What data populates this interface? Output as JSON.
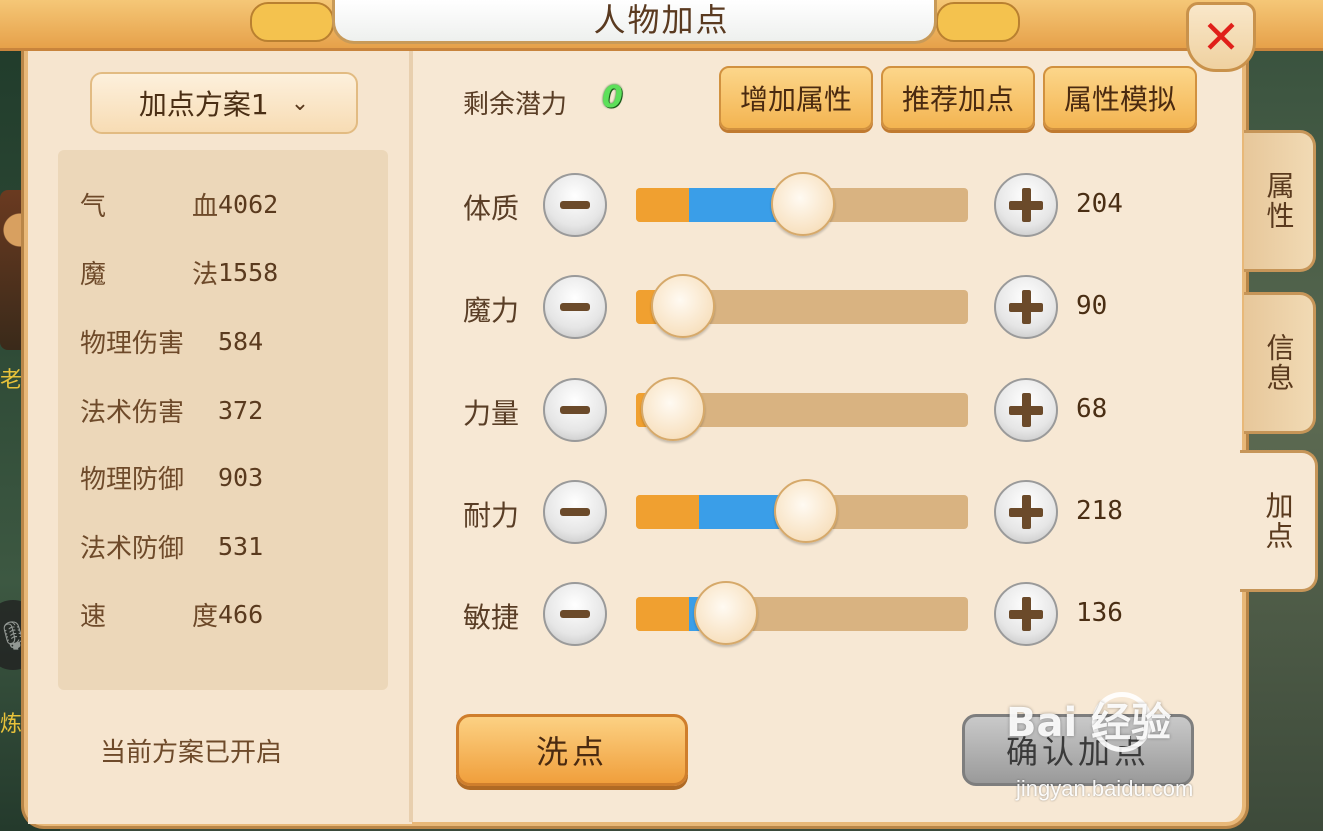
{
  "window": {
    "title": "人物加点",
    "close_icon": "close-icon"
  },
  "background": {
    "text_left_1": "老",
    "text_left_2": "炼"
  },
  "left_panel": {
    "scheme_selector": "加点方案1",
    "stats": [
      {
        "name_a": "气",
        "name_b": "血",
        "value": "4062"
      },
      {
        "name_a": "魔",
        "name_b": "法",
        "value": "1558"
      },
      {
        "name_a": "物理伤害",
        "name_b": "",
        "value": "584"
      },
      {
        "name_a": "法术伤害",
        "name_b": "",
        "value": "372"
      },
      {
        "name_a": "物理防御",
        "name_b": "",
        "value": "903"
      },
      {
        "name_a": "法术防御",
        "name_b": "",
        "value": "531"
      },
      {
        "name_a": "速",
        "name_b": "度",
        "value": "466"
      }
    ],
    "status": "当前方案已开启"
  },
  "right_panel": {
    "potential_label": "剩余潜力",
    "potential_value": "0",
    "buttons": {
      "add_attr": "增加属性",
      "recommend": "推荐加点",
      "simulate": "属性模拟"
    },
    "attributes": [
      {
        "label": "体质",
        "value": "204",
        "base_fraction": 0.16,
        "total_fraction": 0.46
      },
      {
        "label": "魔力",
        "value": "90",
        "base_fraction": 0.1,
        "total_fraction": 0.1
      },
      {
        "label": "力量",
        "value": "68",
        "base_fraction": 0.07,
        "total_fraction": 0.07
      },
      {
        "label": "耐力",
        "value": "218",
        "base_fraction": 0.19,
        "total_fraction": 0.47
      },
      {
        "label": "敏捷",
        "value": "136",
        "base_fraction": 0.16,
        "total_fraction": 0.23
      }
    ],
    "wash_button": "洗点",
    "confirm_button": "确认加点"
  },
  "side_tabs": [
    {
      "label": "属性",
      "active": false
    },
    {
      "label": "信息",
      "active": false
    },
    {
      "label": "加点",
      "active": true
    }
  ],
  "watermark": {
    "main": "Bai 经验",
    "sub": "jingyan.baidu.com"
  },
  "colors": {
    "base_fill": "#f0a030",
    "added_fill": "#3a9ee8",
    "potential": "#5de05a"
  }
}
